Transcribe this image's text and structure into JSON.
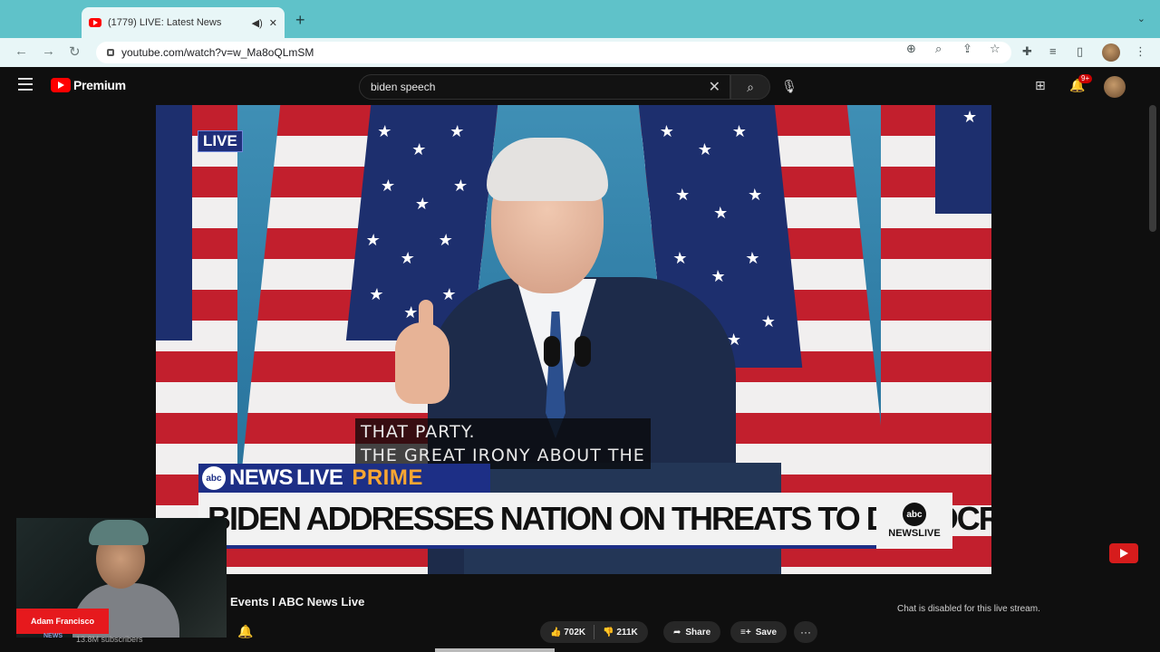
{
  "browser": {
    "tab_title": "(1779) LIVE: Latest News",
    "tab_audio_icon": "speaker-icon",
    "tab_close": "✕",
    "new_tab": "+",
    "url": "youtube.com/watch?v=w_Ma8oQLmSM"
  },
  "youtube": {
    "logo_text": "Premium",
    "search_value": "biden speech",
    "notification_badge": "9+"
  },
  "video": {
    "live_badge": "LIVE",
    "caption_line1": "THAT PARTY.",
    "caption_line2": "THE GREAT IRONY ABOUT THE",
    "newsbar_abc": "abc",
    "newsbar_news": "NEWS",
    "newsbar_live": "LIVE",
    "newsbar_prime": "PRIME",
    "headline": "BIDEN ADDRESSES NATION ON THREATS TO DEMOCRACY",
    "corner_abc": "abc",
    "corner_text": "NEWSLIVE"
  },
  "streamer": {
    "name": "Adam Francisco"
  },
  "below": {
    "title_fragment": "Events I ABC News Live",
    "channel_mini": "NEWS",
    "subscribers": "13.8M subscribers",
    "likes": "702K",
    "dislikes": "211K",
    "share": "Share",
    "save": "Save",
    "more": "···",
    "chat_disabled": "Chat is disabled for this live stream."
  }
}
